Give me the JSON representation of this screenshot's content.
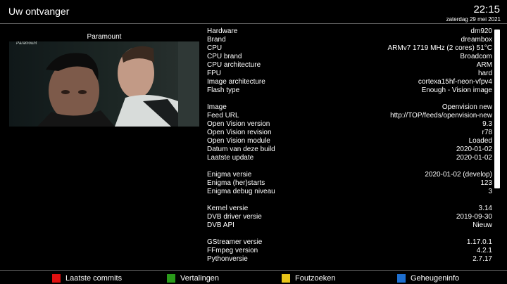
{
  "header": {
    "title": "Uw ontvanger",
    "time": "22:15",
    "date": "zaterdag 29 mei 2021"
  },
  "preview": {
    "channel": "Paramount",
    "watermark": "Paramount"
  },
  "info_rows": [
    {
      "label": "Hardware",
      "value": "dm920"
    },
    {
      "label": "Brand",
      "value": "dreambox"
    },
    {
      "label": "CPU",
      "value": "ARMv7 1719 MHz (2 cores) 51°C"
    },
    {
      "label": "CPU brand",
      "value": "Broadcom"
    },
    {
      "label": "CPU architecture",
      "value": "ARM"
    },
    {
      "label": "FPU",
      "value": "hard"
    },
    {
      "label": "Image architecture",
      "value": "cortexa15hf-neon-vfpv4"
    },
    {
      "label": "Flash type",
      "value": "Enough - Vision image"
    },
    {
      "label": "",
      "value": ""
    },
    {
      "label": "Image",
      "value": "Openvision new"
    },
    {
      "label": "Feed URL",
      "value": "http://TOP/feeds/openvision-new"
    },
    {
      "label": "Open Vision version",
      "value": "9.3"
    },
    {
      "label": "Open Vision revision",
      "value": "r78"
    },
    {
      "label": "Open Vision module",
      "value": "Loaded"
    },
    {
      "label": "Datum van deze build",
      "value": "2020-01-02"
    },
    {
      "label": "Laatste update",
      "value": "2020-01-02"
    },
    {
      "label": "",
      "value": ""
    },
    {
      "label": "Enigma versie",
      "value": "2020-01-02 (develop)"
    },
    {
      "label": "Enigma (her)starts",
      "value": "123"
    },
    {
      "label": "Enigma debug niveau",
      "value": "3"
    },
    {
      "label": "",
      "value": ""
    },
    {
      "label": "Kernel versie",
      "value": "3.14"
    },
    {
      "label": "DVB driver versie",
      "value": "2019-09-30"
    },
    {
      "label": "DVB API",
      "value": "Nieuw"
    },
    {
      "label": "",
      "value": ""
    },
    {
      "label": "GStreamer versie",
      "value": "1.17.0.1"
    },
    {
      "label": "FFmpeg version",
      "value": "4.2.1"
    },
    {
      "label": "Pythonversie",
      "value": "2.7.17"
    }
  ],
  "footer": {
    "red": {
      "label": "Laatste commits",
      "color": "#e01010"
    },
    "green": {
      "label": "Vertalingen",
      "color": "#2a9a1a"
    },
    "yellow": {
      "label": "Foutzoeken",
      "color": "#e8c418"
    },
    "blue": {
      "label": "Geheugeninfo",
      "color": "#1e6fd0"
    }
  }
}
